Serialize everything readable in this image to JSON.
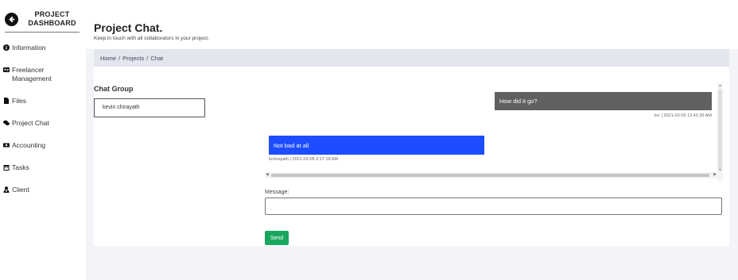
{
  "sidebar": {
    "brand": {
      "line1": "PROJECT",
      "line2": "DASHBOARD",
      "icon": "back-arrow-circle-icon"
    },
    "items": [
      {
        "label": "Information",
        "icon": "info-circle-icon"
      },
      {
        "label": "Freelancer Management",
        "icon": "id-card-icon"
      },
      {
        "label": "Files",
        "icon": "file-icon"
      },
      {
        "label": "Project Chat",
        "icon": "comments-icon"
      },
      {
        "label": "Accounting",
        "icon": "money-bill-icon"
      },
      {
        "label": "Tasks",
        "icon": "calendar-icon"
      },
      {
        "label": "Client",
        "icon": "user-tie-icon"
      }
    ]
  },
  "header": {
    "title": "Project Chat.",
    "subtitle": "Keep in touch with all collaborators in your project."
  },
  "breadcrumb": {
    "home": "Home",
    "projects": "Projects",
    "current": "Chat",
    "separator": "/"
  },
  "chat": {
    "group_title": "Chat Group",
    "groups": [
      {
        "name": "kevin chirayath"
      }
    ],
    "messages": [
      {
        "text": "How did it go?",
        "meta": "mc | 2021-03-03 12:41:39 AM",
        "bg": "#606060"
      },
      {
        "text": "Not bad at all",
        "meta": "kchirayath | 2021-03-05 2:17:18 AM",
        "bg": "#1d4dff"
      }
    ],
    "message_label": "Message:",
    "message_value": "",
    "send_label": "Send"
  },
  "colors": {
    "send_button": "#19a75f",
    "breadcrumb_bg": "#e4e6ef",
    "page_bg": "#f3f4f8"
  }
}
